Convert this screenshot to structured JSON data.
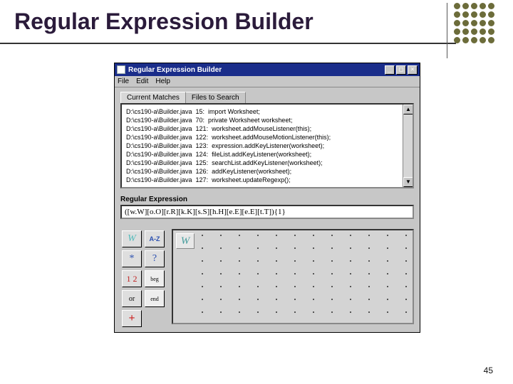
{
  "slide": {
    "title": "Regular Expression Builder",
    "page_number": "45"
  },
  "window": {
    "title": "Regular Expression Builder",
    "controls": {
      "minimize": "_",
      "maximize": "□",
      "close": "×"
    },
    "menu": {
      "file": "File",
      "edit": "Edit",
      "help": "Help"
    },
    "tabs": {
      "current": "Current Matches",
      "files": "Files to Search"
    },
    "matches": [
      {
        "path": "D:\\cs190-a\\Builder.java",
        "line": "15",
        "text": "import Worksheet;"
      },
      {
        "path": "D:\\cs190-a\\Builder.java",
        "line": "70",
        "text": "private Worksheet worksheet;"
      },
      {
        "path": "D:\\cs190-a\\Builder.java",
        "line": "121",
        "text": "worksheet.addMouseListener(this);"
      },
      {
        "path": "D:\\cs190-a\\Builder.java",
        "line": "122",
        "text": "worksheet.addMouseMotionListener(this);"
      },
      {
        "path": "D:\\cs190-a\\Builder.java",
        "line": "123",
        "text": "expression.addKeyListener(worksheet);"
      },
      {
        "path": "D:\\cs190-a\\Builder.java",
        "line": "124",
        "text": "fileList.addKeyListener(worksheet);"
      },
      {
        "path": "D:\\cs190-a\\Builder.java",
        "line": "125",
        "text": "searchList.addKeyListener(worksheet);"
      },
      {
        "path": "D:\\cs190-a\\Builder.java",
        "line": "126",
        "text": "addKeyListener(worksheet);"
      },
      {
        "path": "D:\\cs190-a\\Builder.java",
        "line": "127",
        "text": "worksheet.updateRegexp();"
      }
    ],
    "scroll": {
      "up": "▲",
      "down": "▼"
    },
    "regex_label": "Regular Expression",
    "regex_value": "([w.W][o.O][r.R][k.K][s.S][h.H][e.E][e.E][t.T]){1}",
    "palette": {
      "w": "W",
      "az": "A-Z",
      "star": "*",
      "qmark": "?",
      "num": "1 2",
      "beg": "beg",
      "or": "or",
      "end": "end",
      "plus": "+"
    },
    "workspace_chip": "W"
  }
}
